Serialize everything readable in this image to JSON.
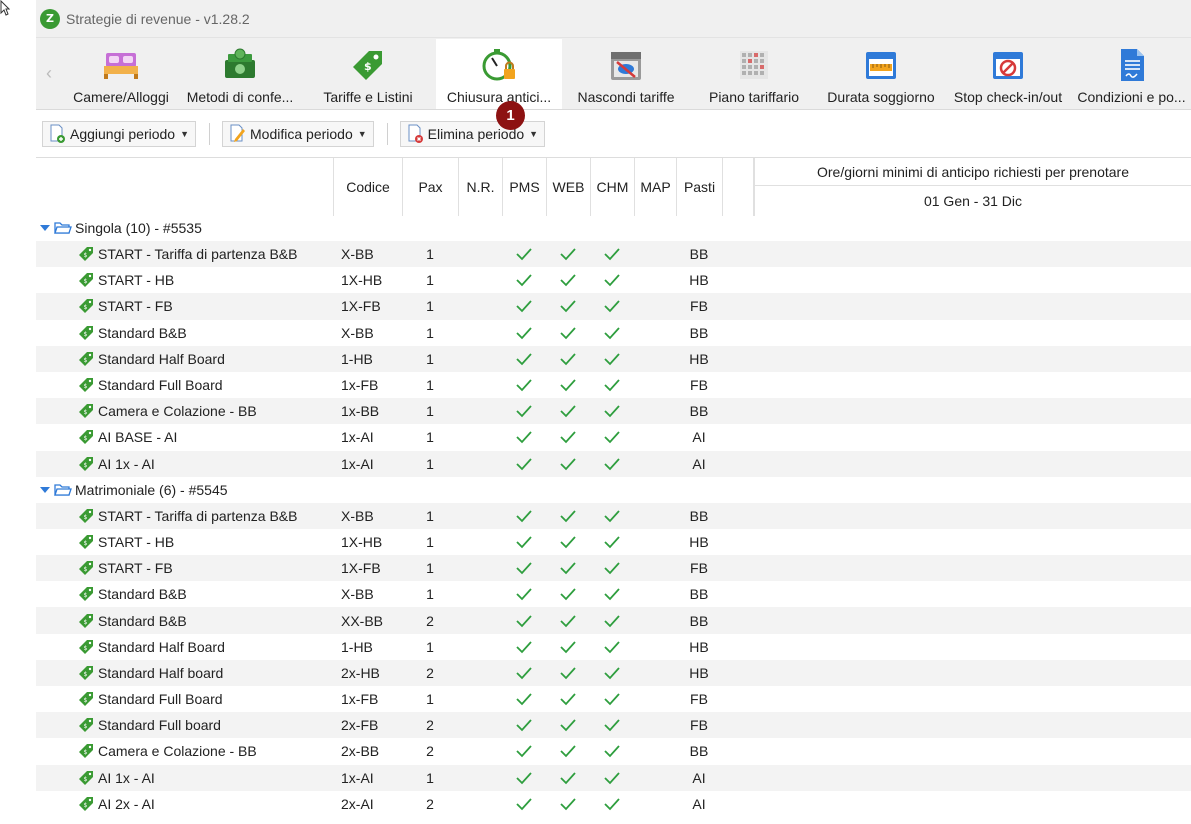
{
  "window": {
    "title": "Strategie di revenue - v1.28.2",
    "logo_text": "Z"
  },
  "ribbon": {
    "tabs": [
      {
        "label": "Camere/Alloggi",
        "icon": "bed-icon"
      },
      {
        "label": "Metodi di confe...",
        "icon": "money-icon"
      },
      {
        "label": "Tariffe e Listini",
        "icon": "price-tag-icon"
      },
      {
        "label": "Chiusura antici...",
        "icon": "timer-lock-icon",
        "active": true
      },
      {
        "label": "Nascondi tariffe",
        "icon": "calendar-hide-icon"
      },
      {
        "label": "Piano tariffario",
        "icon": "grid-calendar-icon"
      },
      {
        "label": "Durata soggiorno",
        "icon": "calendar-ruler-icon"
      },
      {
        "label": "Stop check-in/out",
        "icon": "calendar-stop-icon"
      },
      {
        "label": "Condizioni e po...",
        "icon": "document-icon"
      }
    ],
    "badge": "1"
  },
  "toolbar": {
    "add_label": "Aggiungi periodo",
    "edit_label": "Modifica periodo",
    "delete_label": "Elimina periodo"
  },
  "columns": {
    "codice": "Codice",
    "pax": "Pax",
    "nr": "N.R.",
    "pms": "PMS",
    "web": "WEB",
    "chm": "CHM",
    "map": "MAP",
    "pasti": "Pasti",
    "ore_title": "Ore/giorni minimi di anticipo richiesti per prenotare",
    "ore_date": "01 Gen - 31 Dic"
  },
  "groups": [
    {
      "label": "Singola (10) - #5535",
      "rows": [
        {
          "name": "START - Tariffa di partenza B&B",
          "code": "X-BB",
          "pax": "1",
          "pasti": "BB"
        },
        {
          "name": "START - HB",
          "code": "1X-HB",
          "pax": "1",
          "pasti": "HB"
        },
        {
          "name": "START - FB",
          "code": "1X-FB",
          "pax": "1",
          "pasti": "FB"
        },
        {
          "name": "Standard B&B",
          "code": "X-BB",
          "pax": "1",
          "pasti": "BB"
        },
        {
          "name": "Standard Half Board",
          "code": "1-HB",
          "pax": "1",
          "pasti": "HB"
        },
        {
          "name": "Standard Full Board",
          "code": "1x-FB",
          "pax": "1",
          "pasti": "FB"
        },
        {
          "name": "Camera e Colazione - BB",
          "code": "1x-BB",
          "pax": "1",
          "pasti": "BB"
        },
        {
          "name": "AI BASE - AI",
          "code": "1x-AI",
          "pax": "1",
          "pasti": "AI"
        },
        {
          "name": "AI 1x - AI",
          "code": "1x-AI",
          "pax": "1",
          "pasti": "AI"
        }
      ]
    },
    {
      "label": "Matrimoniale (6) - #5545",
      "rows": [
        {
          "name": "START - Tariffa di partenza B&B",
          "code": "X-BB",
          "pax": "1",
          "pasti": "BB"
        },
        {
          "name": "START - HB",
          "code": "1X-HB",
          "pax": "1",
          "pasti": "HB"
        },
        {
          "name": "START - FB",
          "code": "1X-FB",
          "pax": "1",
          "pasti": "FB"
        },
        {
          "name": "Standard B&B",
          "code": "X-BB",
          "pax": "1",
          "pasti": "BB"
        },
        {
          "name": "Standard B&B",
          "code": "XX-BB",
          "pax": "2",
          "pasti": "BB"
        },
        {
          "name": "Standard Half Board",
          "code": "1-HB",
          "pax": "1",
          "pasti": "HB"
        },
        {
          "name": "Standard Half board",
          "code": "2x-HB",
          "pax": "2",
          "pasti": "HB"
        },
        {
          "name": "Standard Full Board",
          "code": "1x-FB",
          "pax": "1",
          "pasti": "FB"
        },
        {
          "name": "Standard Full board",
          "code": "2x-FB",
          "pax": "2",
          "pasti": "FB"
        },
        {
          "name": "Camera e Colazione - BB",
          "code": "2x-BB",
          "pax": "2",
          "pasti": "BB"
        },
        {
          "name": "AI 1x - AI",
          "code": "1x-AI",
          "pax": "1",
          "pasti": "AI"
        },
        {
          "name": "AI 2x - AI",
          "code": "2x-AI",
          "pax": "2",
          "pasti": "AI"
        }
      ]
    }
  ],
  "colors": {
    "check": "#2e9e3e",
    "tag": "#3a9a33",
    "badge": "#8d1212",
    "folder": "#2f7ad8"
  }
}
